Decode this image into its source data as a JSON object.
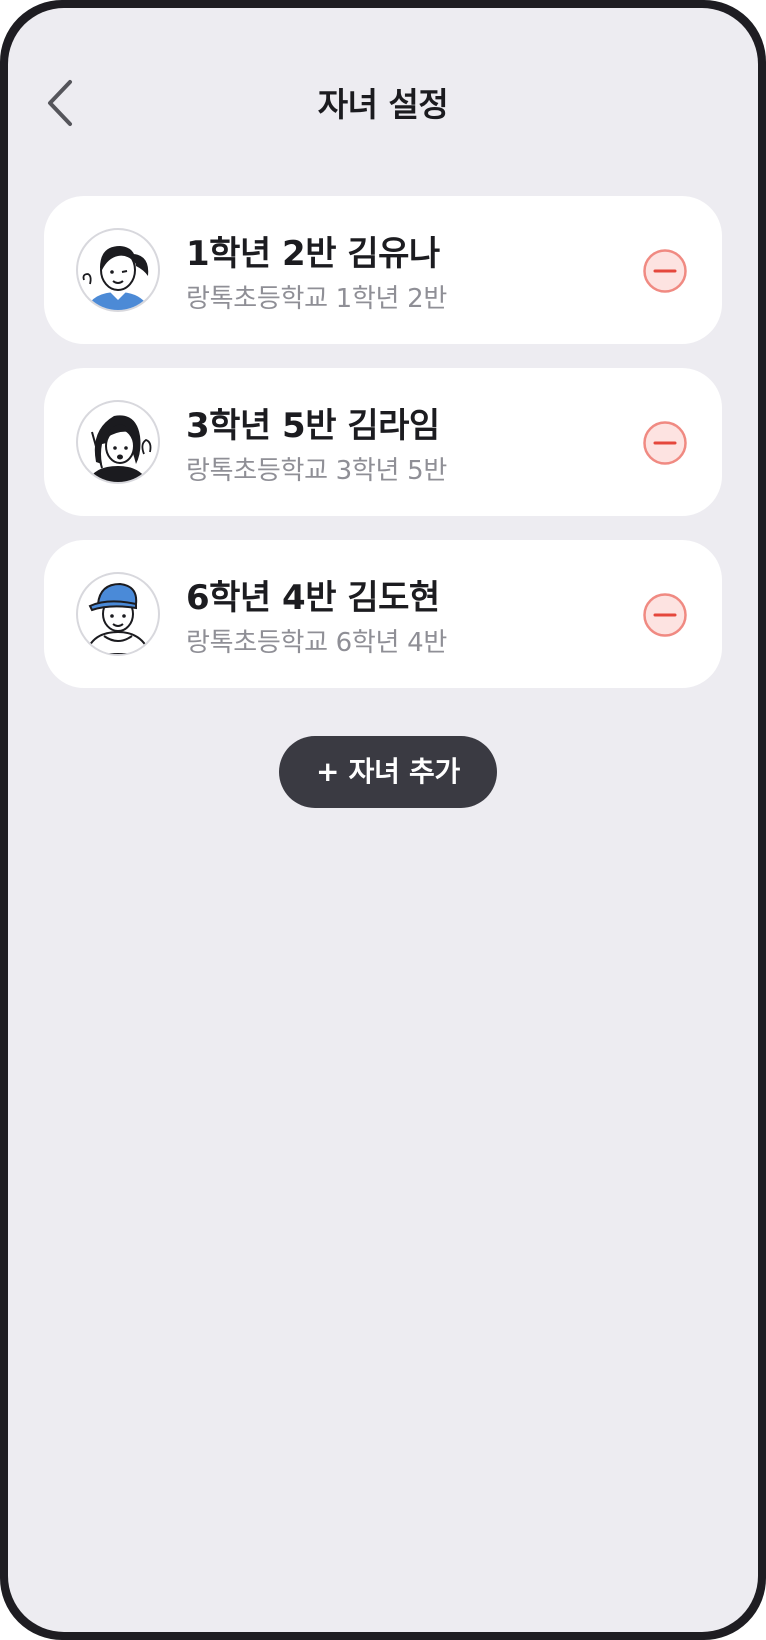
{
  "header": {
    "title": "자녀 설정",
    "back_icon": "chevron-left-icon"
  },
  "children": [
    {
      "name": "1학년 2반 김유나",
      "school": "랑톡초등학교 1학년 2반",
      "avatar": "girl-ponytail-avatar",
      "remove_icon": "minus-circle-icon"
    },
    {
      "name": "3학년 5반 김라임",
      "school": "랑톡초등학교 3학년 5반",
      "avatar": "girl-waving-avatar",
      "remove_icon": "minus-circle-icon"
    },
    {
      "name": "6학년 4반 김도현",
      "school": "랑톡초등학교 6학년 4반",
      "avatar": "boy-cap-avatar",
      "remove_icon": "minus-circle-icon"
    }
  ],
  "add_button": {
    "label": "+ 자녀 추가"
  },
  "colors": {
    "background": "#edecf1",
    "card": "#ffffff",
    "remove_fill": "#fde3e1",
    "remove_stroke": "#f08a82",
    "remove_minus": "#e5473c",
    "button_dark": "#3a3a42",
    "cap_blue": "#4a8ad8"
  }
}
